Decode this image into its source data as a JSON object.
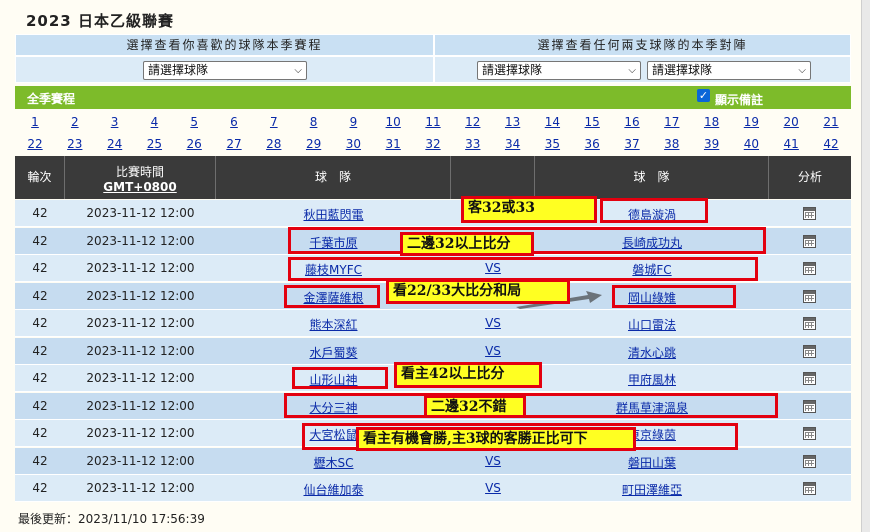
{
  "page": {
    "title": "2023 日本乙級聯賽"
  },
  "selectors": {
    "left_header": "選擇查看你喜歡的球隊本季賽程",
    "right_header": "選擇查看任何兩支球隊的本季對陣",
    "left_select": "請選擇球隊",
    "right_select_a": "請選擇球隊",
    "right_select_b": "請選擇球隊"
  },
  "bar": {
    "season_label": "全季賽程",
    "show_notes_label": "顯示備註",
    "show_notes_checked": true
  },
  "rounds_row1": [
    "1",
    "2",
    "3",
    "4",
    "5",
    "6",
    "7",
    "8",
    "9",
    "10",
    "11",
    "12",
    "13",
    "14",
    "15",
    "16",
    "17",
    "18",
    "19",
    "20",
    "21"
  ],
  "rounds_row2": [
    "22",
    "23",
    "24",
    "25",
    "26",
    "27",
    "28",
    "29",
    "30",
    "31",
    "32",
    "33",
    "34",
    "35",
    "36",
    "37",
    "38",
    "39",
    "40",
    "41",
    "42"
  ],
  "table": {
    "headers": {
      "round": "輪次",
      "time_line1": "比賽時間",
      "time_line2": "GMT+0800",
      "home": "球　隊",
      "away": "球　隊",
      "analysis": "分析"
    },
    "rows": [
      {
        "round": "42",
        "time": "2023-11-12 12:00",
        "home": "秋田藍閃電",
        "vs": "",
        "away": "德島漩渦"
      },
      {
        "round": "42",
        "time": "2023-11-12 12:00",
        "home": "千葉市原",
        "vs": "",
        "away": "長崎成功丸"
      },
      {
        "round": "42",
        "time": "2023-11-12 12:00",
        "home": "藤枝MYFC",
        "vs": "VS",
        "away": "磐城FC"
      },
      {
        "round": "42",
        "time": "2023-11-12 12:00",
        "home": "金澤薩維根",
        "vs": "",
        "away": "岡山綠雉"
      },
      {
        "round": "42",
        "time": "2023-11-12 12:00",
        "home": "熊本深紅",
        "vs": "VS",
        "away": "山口雷法"
      },
      {
        "round": "42",
        "time": "2023-11-12 12:00",
        "home": "水戶蜀葵",
        "vs": "VS",
        "away": "清水心跳"
      },
      {
        "round": "42",
        "time": "2023-11-12 12:00",
        "home": "山形山神",
        "vs": "",
        "away": "甲府風林"
      },
      {
        "round": "42",
        "time": "2023-11-12 12:00",
        "home": "大分三神",
        "vs": "",
        "away": "群馬草津溫泉"
      },
      {
        "round": "42",
        "time": "2023-11-12 12:00",
        "home": "大宮松鼠",
        "vs": "",
        "away": "東京綠茵"
      },
      {
        "round": "42",
        "time": "2023-11-12 12:00",
        "home": "櫪木SC",
        "vs": "VS",
        "away": "磐田山葉"
      },
      {
        "round": "42",
        "time": "2023-11-12 12:00",
        "home": "仙台維加泰",
        "vs": "VS",
        "away": "町田澤維亞"
      }
    ]
  },
  "footer": {
    "last_update": "最後更新：2023/11/10 17:56:39"
  },
  "annotations": [
    "客32或33",
    "二邊32以上比分",
    "看22/33大比分和局",
    "看主42以上比分",
    "二邊32不錯",
    "看主有機會勝,主3球的客勝正比可下"
  ],
  "colors": {
    "header_blue": "#c9e0f3",
    "green_bar": "#7dbb2a",
    "table_header": "#3a3a3a",
    "row_light": "#dcebf7",
    "row_dark": "#c6dcf0",
    "link": "#0a2aa8",
    "highlight_red": "#e3000f",
    "note_yellow": "#ffff22"
  }
}
